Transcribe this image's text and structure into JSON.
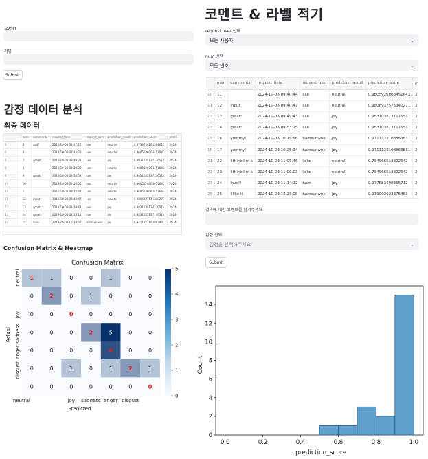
{
  "left": {
    "user_id_label": "유저ID",
    "review_label": "리뷰",
    "submit_label": "Submit",
    "analysis_title": "감정 데이터 분석",
    "final_data_title": "최종 데이터",
    "final_table": {
      "columns": [
        "",
        "num",
        "comments",
        "request_time",
        "request_user",
        "prediction_result",
        "prediction_score",
        "predi"
      ],
      "rows": [
        [
          "5",
          "3",
          "asdf",
          "2024-10-08 09:17:17",
          "sae",
          "neutral",
          "0.9733758261398617",
          "2024-"
        ],
        [
          "6",
          "6",
          "",
          "2024-10-08 09:38:20",
          "sae",
          "neutral",
          "0.9605526068451643",
          "2024-"
        ],
        [
          "7",
          "7",
          "great!",
          "2024-10-08 09:39:23",
          "sae",
          "joy",
          "0.9831035137176514",
          "2024-"
        ],
        [
          "8",
          "8",
          "",
          "2024-10-08 09:40:00",
          "sae",
          "neutral",
          "0.9605526068451643",
          "2024-"
        ],
        [
          "9",
          "9",
          "great!",
          "2024-10-08 09:40:53",
          "sae",
          "joy",
          "0.9831035137176514",
          "2024-"
        ],
        [
          "10",
          "10",
          "",
          "2024-10-08 09:40:36",
          "sae",
          "neutral",
          "0.9605526068451643",
          "2024-"
        ],
        [
          "10",
          "11",
          "",
          "2024-10-08 09:40:44",
          "sae",
          "neutral",
          "0.9605526068451643",
          "2024-"
        ],
        [
          "11",
          "12",
          "input",
          "2024-10-08 09:40:47",
          "sae",
          "neutral",
          "0.9806937575340271",
          "2024-"
        ],
        [
          "12",
          "13",
          "great!",
          "2024-10-08 09:49:43",
          "sae",
          "joy",
          "0.9831035137176514",
          "2024-"
        ],
        [
          "13",
          "14",
          "great!",
          "2024-10-08 09:53:15",
          "sae",
          "joy",
          "0.9831035137176514",
          "2024-"
        ],
        [
          "14",
          "15",
          "love",
          "2024-10-08 10:19:56",
          "hamsunwoo",
          "joy",
          "0.9711123108863831",
          "2024-"
        ]
      ]
    },
    "cm_section_title": "Confusion Matrix & Heatmap",
    "confusion": {
      "title": "Confusion Matrix",
      "xlabel": "Predicted",
      "ylabel": "Actual",
      "x_ticks": [
        "neutral",
        "joy",
        "sadness",
        "anger",
        "disgust"
      ],
      "y_ticks": [
        "neutral",
        "joy",
        "sadness",
        "anger",
        "disgust"
      ],
      "cells": [
        [
          1,
          1,
          0,
          0,
          1,
          0,
          0
        ],
        [
          0,
          2,
          0,
          1,
          0,
          0,
          0
        ],
        [
          0,
          0,
          0,
          0,
          0,
          0,
          0
        ],
        [
          0,
          0,
          0,
          2,
          5,
          0,
          0
        ],
        [
          0,
          0,
          0,
          0,
          4,
          0,
          0
        ],
        [
          0,
          0,
          1,
          0,
          1,
          2,
          1
        ],
        [
          0,
          0,
          0,
          0,
          0,
          0,
          0
        ]
      ],
      "colorbar_ticks": [
        "0",
        "1",
        "2",
        "3",
        "4",
        "5"
      ],
      "colors": {
        "high": "#08306b",
        "low": "#f7fbff",
        "diag": "#e8191b"
      }
    }
  },
  "right": {
    "title": "코멘트 & 라벨 적기",
    "user_select_label": "request user 선택",
    "user_select_value": "모든 사용자",
    "num_select_label": "num 선택",
    "num_select_value": "모든 번호",
    "table": {
      "columns": [
        "",
        "num",
        "comments",
        "request_time",
        "request_user",
        "prediction_result",
        "prediction_score",
        "predictio"
      ],
      "rows": [
        [
          "10",
          "11",
          "",
          "2024-10-08 09:40:44",
          "sae",
          "neutral",
          "0.9605926068451643",
          "2024-"
        ],
        [
          "11",
          "12",
          "input",
          "2024-10-08 09:40:47",
          "sae",
          "neutral",
          "0.9806937575340271",
          "2024-"
        ],
        [
          "12",
          "13",
          "great!",
          "2024-10-08 09:49:43",
          "sae",
          "joy",
          "0.983103513717651",
          "2024-"
        ],
        [
          "13",
          "14",
          "great!",
          "2024-10-08 09:53:15",
          "sae",
          "joy",
          "0.983103513717651",
          "2024-"
        ],
        [
          "15",
          "16",
          "yummy!",
          "2024-10-08 10:19:56",
          "hamsunwoo",
          "joy",
          "0.9711123108863831",
          "2024-"
        ],
        [
          "16",
          "17",
          "yummy!",
          "2024-10-08 10:25:34",
          "hamsunwoo",
          "joy",
          "0.9711123108863831",
          "2024-"
        ],
        [
          "21",
          "22",
          "I think I'm a",
          "2024-10-08 11:05:46",
          "koko",
          "neutral",
          "0.734966518802642",
          "2024-"
        ],
        [
          "22",
          "23",
          "I think I'm a",
          "2024-10-08 11:06:03",
          "koko",
          "neutral",
          "0.734966518802642",
          "2024-"
        ],
        [
          "23",
          "24",
          "love!!",
          "2024-10-08 11:14:12",
          "ham",
          "joy",
          "0.977583498355712",
          "2024-"
        ],
        [
          "25",
          "26",
          "I like it",
          "2024-10-08 12:23:08",
          "hamsunwoo",
          "joy",
          "0.919992622375483",
          "2024-"
        ],
        [
          "26",
          "27",
          "loving",
          "2024-10-08 12:23:08",
          "hamsunwoo",
          "joy",
          "0.9007508087093",
          "2024-"
        ]
      ]
    },
    "comment_label": "결과에 대한 코멘트를 남겨주세요",
    "emotion_label": "감정 선택",
    "emotion_placeholder": "감정을 선택해주세요",
    "submit_label": "Submit"
  },
  "chart_data": {
    "type": "bar",
    "xlabel": "prediction_score",
    "ylabel": "Count",
    "xlim": [
      -0.05,
      1.05
    ],
    "ylim": [
      0,
      16
    ],
    "x_ticks": [
      0.0,
      0.2,
      0.4,
      0.6,
      0.8,
      1.0
    ],
    "y_ticks": [
      0,
      2,
      4,
      6,
      8,
      10,
      12,
      14
    ],
    "bins": [
      {
        "start": 0.5,
        "end": 0.6,
        "count": 1
      },
      {
        "start": 0.6,
        "end": 0.7,
        "count": 1
      },
      {
        "start": 0.7,
        "end": 0.8,
        "count": 3
      },
      {
        "start": 0.8,
        "end": 0.9,
        "count": 2
      },
      {
        "start": 0.9,
        "end": 1.0,
        "count": 15
      }
    ],
    "bar_color": "#5fa0cd",
    "bar_edge": "#2c5f87"
  }
}
